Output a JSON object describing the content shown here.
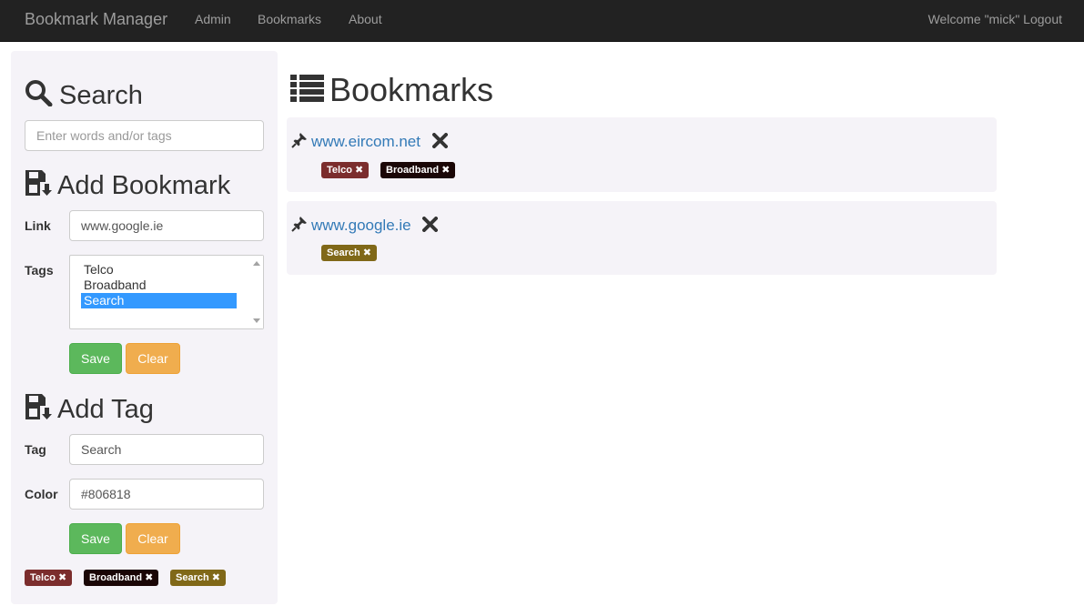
{
  "navbar": {
    "brand": "Bookmark Manager",
    "links": [
      "Admin",
      "Bookmarks",
      "About"
    ],
    "welcome": "Welcome \"mick\" Logout"
  },
  "search": {
    "heading": "Search",
    "placeholder": "Enter words and/or tags"
  },
  "add_bookmark": {
    "heading": "Add Bookmark",
    "link_label": "Link",
    "link_value": "www.google.ie",
    "tags_label": "Tags",
    "tag_options": [
      "Telco",
      "Broadband",
      "Search"
    ],
    "selected_tag": "Search",
    "save_label": "Save",
    "clear_label": "Clear"
  },
  "add_tag": {
    "heading": "Add Tag",
    "tag_label": "Tag",
    "tag_value": "Search",
    "color_label": "Color",
    "color_value": "#806818",
    "save_label": "Save",
    "clear_label": "Clear"
  },
  "tag_list": [
    {
      "name": "Telco",
      "color": "#7b2d2d"
    },
    {
      "name": "Broadband",
      "color": "#1a0606"
    },
    {
      "name": "Search",
      "color": "#806818"
    }
  ],
  "bookmarks_heading": "Bookmarks",
  "bookmarks": [
    {
      "url": "www.eircom.net",
      "tags": [
        "Telco",
        "Broadband"
      ]
    },
    {
      "url": "www.google.ie",
      "tags": [
        "Search"
      ]
    }
  ]
}
